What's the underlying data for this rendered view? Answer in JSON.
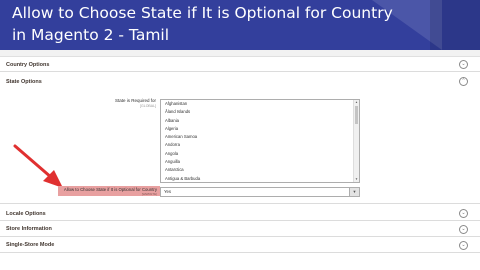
{
  "video": {
    "title_line1": "Allow to Choose State if It is Optional for Country",
    "title_line2": "in Magento 2 - Tamil"
  },
  "sections": {
    "country_options": "Country Options",
    "state_options": "State Options",
    "locale_options": "Locale Options",
    "store_information": "Store Information",
    "single_store_mode": "Single-Store Mode"
  },
  "state_required": {
    "label": "State is Required for",
    "scope": "[GLOBAL]",
    "options": [
      "Afghanistan",
      "Åland Islands",
      "Albania",
      "Algeria",
      "American Samoa",
      "Andorra",
      "Angola",
      "Anguilla",
      "Antarctica",
      "Antigua & Barbuda"
    ]
  },
  "allow_choose": {
    "label": "Allow to Choose State if It is Optional for Country",
    "scope": "[WEBSITE]",
    "value": "Yes"
  },
  "colors": {
    "banner": "#333f9c",
    "highlight": "#e8a0a0",
    "arrow": "#e03030"
  },
  "icons": [
    "chevron-up-icon",
    "chevron-down-icon",
    "red-arrow-icon"
  ]
}
